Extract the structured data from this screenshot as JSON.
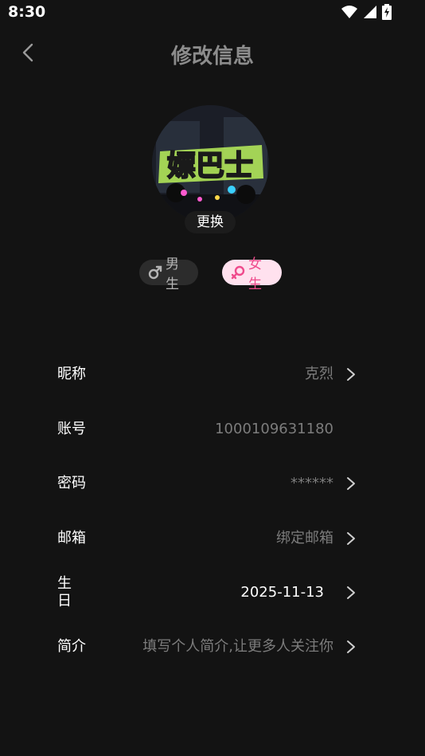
{
  "status": {
    "time": "8:30"
  },
  "header": {
    "title": "修改信息"
  },
  "avatar": {
    "change_label": "更换",
    "logo_text": "嫖巴士"
  },
  "gender": {
    "male_label": "男生",
    "female_label": "女生"
  },
  "fields": {
    "nickname": {
      "label": "昵称",
      "value": "克烈"
    },
    "account": {
      "label": "账号",
      "value": "1000109631180"
    },
    "password": {
      "label": "密码",
      "value": "******"
    },
    "email": {
      "label": "邮箱",
      "value": "绑定邮箱"
    },
    "birthday": {
      "label_line1": "生",
      "label_line2": "日",
      "value": "2025-11-13"
    },
    "bio": {
      "label": "简介",
      "value": "填写个人简介,让更多人关注你"
    }
  },
  "colors": {
    "background": "#131313",
    "female_bg": "#ffe1ee",
    "female_text": "#ef4b8c"
  }
}
